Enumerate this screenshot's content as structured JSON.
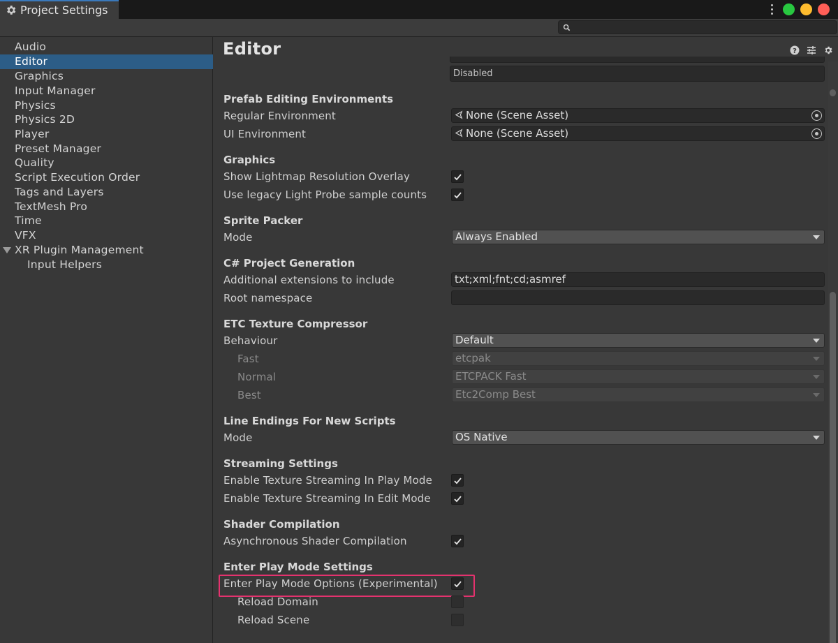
{
  "window": {
    "tab_title": "Project Settings",
    "traffic_colors": [
      "#28c840",
      "#febc2e",
      "#ff5f57"
    ]
  },
  "sidebar": {
    "items": [
      {
        "label": "Audio"
      },
      {
        "label": "Editor"
      },
      {
        "label": "Graphics"
      },
      {
        "label": "Input Manager"
      },
      {
        "label": "Physics"
      },
      {
        "label": "Physics 2D"
      },
      {
        "label": "Player"
      },
      {
        "label": "Preset Manager"
      },
      {
        "label": "Quality"
      },
      {
        "label": "Script Execution Order"
      },
      {
        "label": "Tags and Layers"
      },
      {
        "label": "TextMesh Pro"
      },
      {
        "label": "Time"
      },
      {
        "label": "VFX"
      },
      {
        "label": "XR Plugin Management"
      },
      {
        "label": "Input Helpers"
      }
    ],
    "selected": "Editor"
  },
  "main": {
    "title": "Editor",
    "cut_field_value": "Disabled",
    "prefab": {
      "heading": "Prefab Editing Environments",
      "regular_label": "Regular Environment",
      "regular_value": "None (Scene Asset)",
      "ui_label": "UI Environment",
      "ui_value": "None (Scene Asset)"
    },
    "graphics": {
      "heading": "Graphics",
      "lightmap_label": "Show Lightmap Resolution Overlay",
      "lightprobe_label": "Use legacy Light Probe sample counts"
    },
    "sprite": {
      "heading": "Sprite Packer",
      "mode_label": "Mode",
      "mode_value": "Always Enabled"
    },
    "csharp": {
      "heading": "C# Project Generation",
      "ext_label": "Additional extensions to include",
      "ext_value": "txt;xml;fnt;cd;asmref",
      "ns_label": "Root namespace",
      "ns_value": ""
    },
    "etc": {
      "heading": "ETC Texture Compressor",
      "behaviour_label": "Behaviour",
      "behaviour_value": "Default",
      "fast_label": "Fast",
      "fast_value": "etcpak",
      "normal_label": "Normal",
      "normal_value": "ETCPACK Fast",
      "best_label": "Best",
      "best_value": "Etc2Comp Best"
    },
    "line_endings": {
      "heading": "Line Endings For New Scripts",
      "mode_label": "Mode",
      "mode_value": "OS Native"
    },
    "streaming": {
      "heading": "Streaming Settings",
      "play_label": "Enable Texture Streaming In Play Mode",
      "edit_label": "Enable Texture Streaming In Edit Mode"
    },
    "shader": {
      "heading": "Shader Compilation",
      "async_label": "Asynchronous Shader Compilation"
    },
    "play_mode": {
      "heading": "Enter Play Mode Settings",
      "options_label": "Enter Play Mode Options (Experimental)",
      "reload_domain_label": "Reload Domain",
      "reload_scene_label": "Reload Scene"
    },
    "highlight_color": "#e4326e",
    "selection_color": "#2c5d87"
  }
}
